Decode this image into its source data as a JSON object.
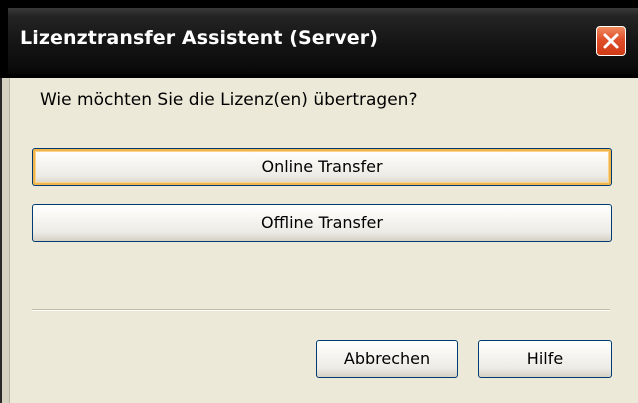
{
  "window": {
    "title": "Lizenztransfer Assistent (Server)",
    "close_icon": "close-icon",
    "accent_close": "#e0502a"
  },
  "dialog": {
    "question": "Wie möchten Sie die Lizenz(en) übertragen?",
    "online_transfer_label": "Online Transfer",
    "offline_transfer_label": "Offline Transfer"
  },
  "footer": {
    "cancel_label": "Abbrechen",
    "help_label": "Hilfe"
  }
}
